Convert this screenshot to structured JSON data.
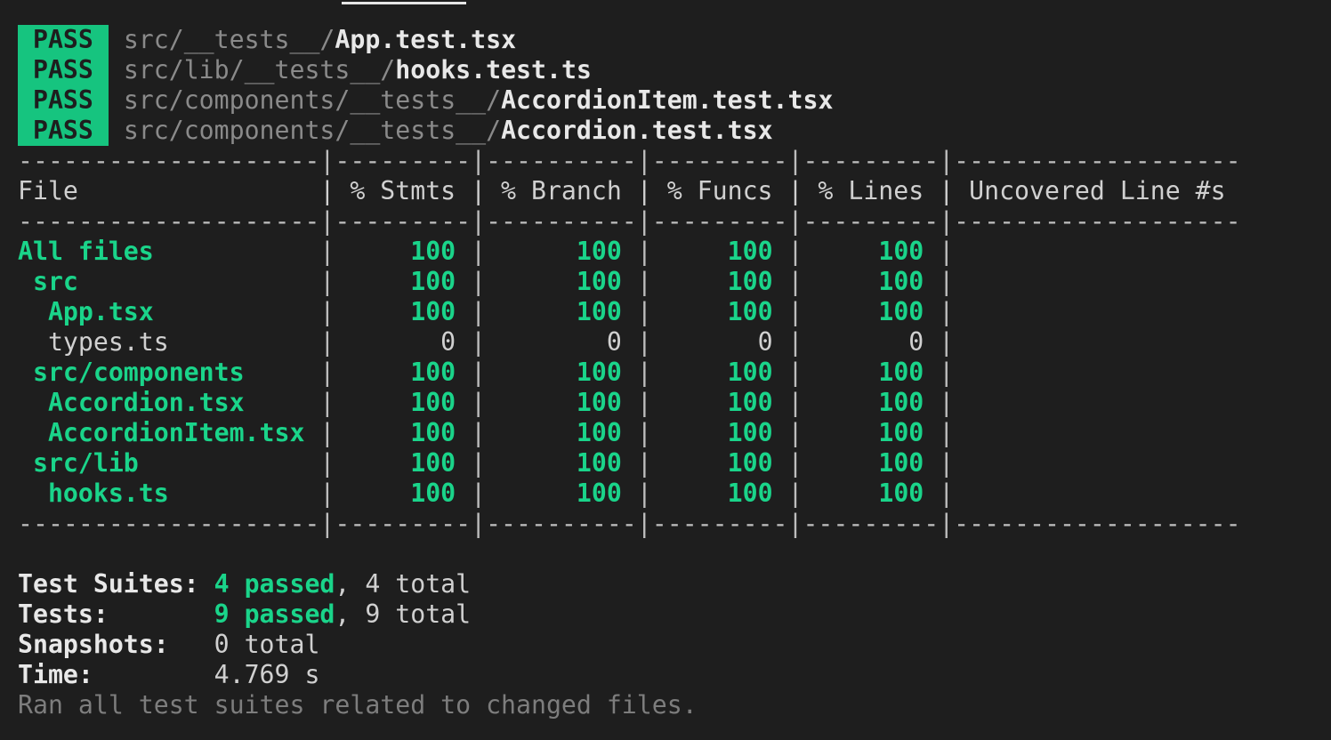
{
  "results": [
    {
      "status": "PASS",
      "dir": "src/__tests__/",
      "file": "App.test.tsx"
    },
    {
      "status": "PASS",
      "dir": "src/lib/__tests__/",
      "file": "hooks.test.ts"
    },
    {
      "status": "PASS",
      "dir": "src/components/__tests__/",
      "file": "AccordionItem.test.tsx"
    },
    {
      "status": "PASS",
      "dir": "src/components/__tests__/",
      "file": "Accordion.test.tsx"
    }
  ],
  "coverage": {
    "separator": "--------------------|---------|----------|---------|---------|-------------------",
    "header": "File                | % Stmts | % Branch | % Funcs | % Lines | Uncovered Line #s ",
    "rows": [
      {
        "name": "All files",
        "indent": 0,
        "stmts": "100",
        "branch": "100",
        "funcs": "100",
        "lines": "100",
        "uncovered": "",
        "covered": true
      },
      {
        "name": "src",
        "indent": 1,
        "stmts": "100",
        "branch": "100",
        "funcs": "100",
        "lines": "100",
        "uncovered": "",
        "covered": true
      },
      {
        "name": "App.tsx",
        "indent": 2,
        "stmts": "100",
        "branch": "100",
        "funcs": "100",
        "lines": "100",
        "uncovered": "",
        "covered": true
      },
      {
        "name": "types.ts",
        "indent": 2,
        "stmts": "0",
        "branch": "0",
        "funcs": "0",
        "lines": "0",
        "uncovered": "",
        "covered": false
      },
      {
        "name": "src/components",
        "indent": 1,
        "stmts": "100",
        "branch": "100",
        "funcs": "100",
        "lines": "100",
        "uncovered": "",
        "covered": true
      },
      {
        "name": "Accordion.tsx",
        "indent": 2,
        "stmts": "100",
        "branch": "100",
        "funcs": "100",
        "lines": "100",
        "uncovered": "",
        "covered": true
      },
      {
        "name": "AccordionItem.tsx",
        "indent": 2,
        "stmts": "100",
        "branch": "100",
        "funcs": "100",
        "lines": "100",
        "uncovered": "",
        "covered": true
      },
      {
        "name": "src/lib",
        "indent": 1,
        "stmts": "100",
        "branch": "100",
        "funcs": "100",
        "lines": "100",
        "uncovered": "",
        "covered": true
      },
      {
        "name": "hooks.ts",
        "indent": 2,
        "stmts": "100",
        "branch": "100",
        "funcs": "100",
        "lines": "100",
        "uncovered": "",
        "covered": true
      }
    ]
  },
  "summary": {
    "suites_label": "Test Suites: ",
    "suites_passed": "4 passed",
    "suites_total": ", 4 total",
    "tests_label": "Tests:       ",
    "tests_passed": "9 passed",
    "tests_total": ", 9 total",
    "snapshots_label": "Snapshots:   ",
    "snapshots_value": "0 total",
    "time_label": "Time:        ",
    "time_value": "4.769 s",
    "footer": "Ran all test suites related to changed files."
  },
  "colors": {
    "pass": "#16c47f",
    "covered": "#1ad48a",
    "background": "#1e1e1e"
  }
}
